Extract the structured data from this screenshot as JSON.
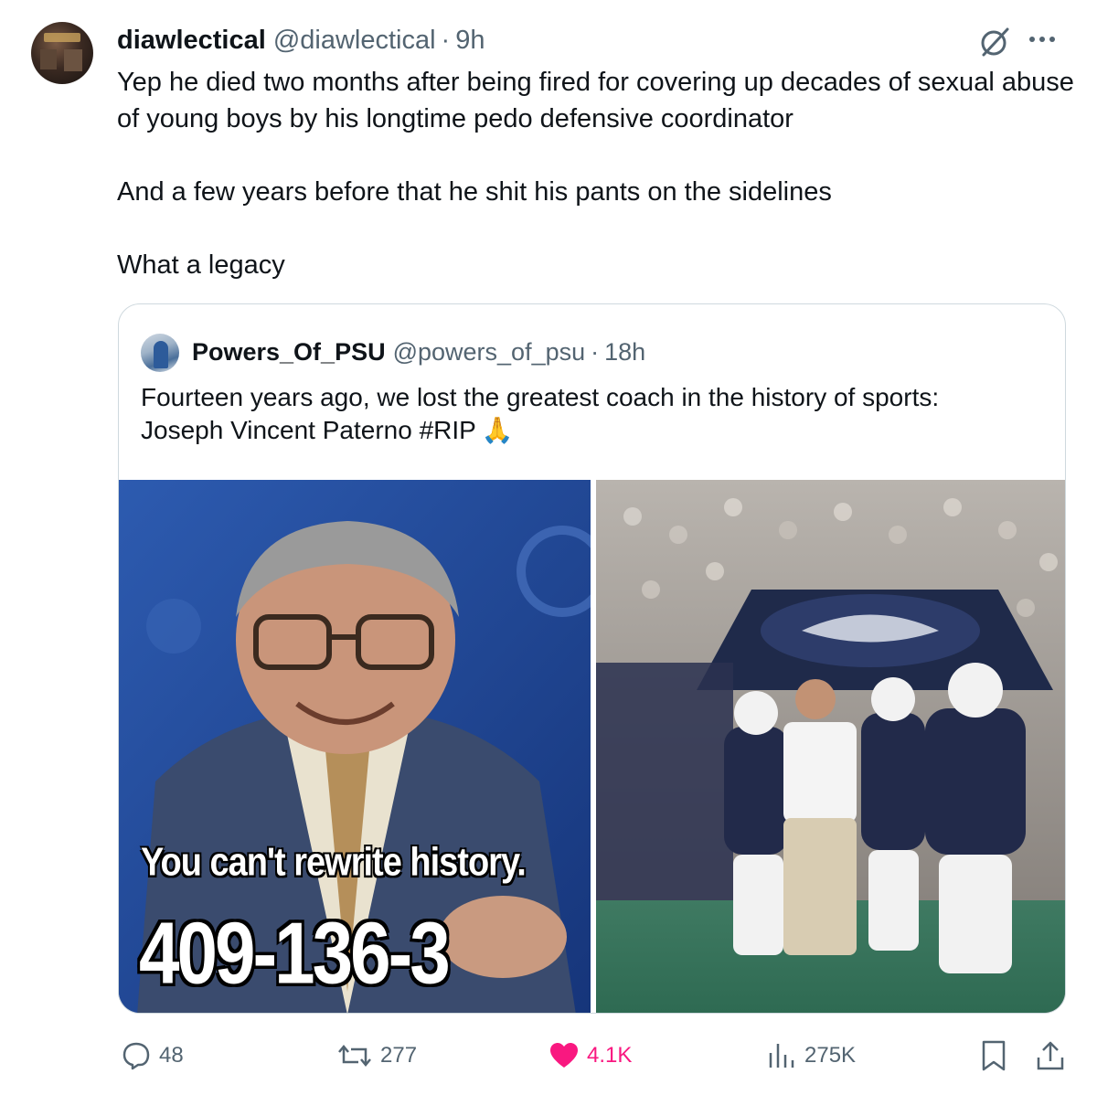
{
  "tweet": {
    "author": {
      "display_name": "diawlectical",
      "handle": "@diawlectical",
      "avatar_icon": "avatar-storefront"
    },
    "separator": "·",
    "time": "9h",
    "text_paragraphs": [
      "Yep he died two months after being fired for covering up decades of sexual abuse of young boys by his longtime pedo defensive coordinator",
      "And a few years before that he shit his pants on the sidelines",
      "What a legacy"
    ],
    "menu_icons": [
      "grok-icon",
      "more-icon"
    ]
  },
  "quoted_tweet": {
    "author": {
      "display_name": "Powers_Of_PSU",
      "handle": "@powers_of_psu",
      "avatar_icon": "avatar-fan"
    },
    "separator": "·",
    "time": "18h",
    "text_line1": "Fourteen years ago, we lost the greatest coach in the history of sports:",
    "text_line2": "Joseph Vincent Paterno #RIP",
    "emoji": "🙏",
    "images": [
      {
        "kind": "meme",
        "caption": "You can't rewrite history.",
        "record": "409-136-3"
      },
      {
        "kind": "photo",
        "subject": "team-running-out-of-tunnel"
      }
    ]
  },
  "actions": {
    "reply": {
      "icon": "reply-icon",
      "count": "48"
    },
    "repost": {
      "icon": "repost-icon",
      "count": "277"
    },
    "like": {
      "icon": "heart-icon",
      "count": "4.1K",
      "liked": true,
      "color": "#f91880"
    },
    "views": {
      "icon": "views-icon",
      "count": "275K"
    },
    "bookmark": {
      "icon": "bookmark-icon"
    },
    "share": {
      "icon": "share-icon"
    }
  },
  "colors": {
    "text": "#0f1419",
    "secondary": "#536471",
    "border": "#cfd9de",
    "like": "#f91880"
  }
}
